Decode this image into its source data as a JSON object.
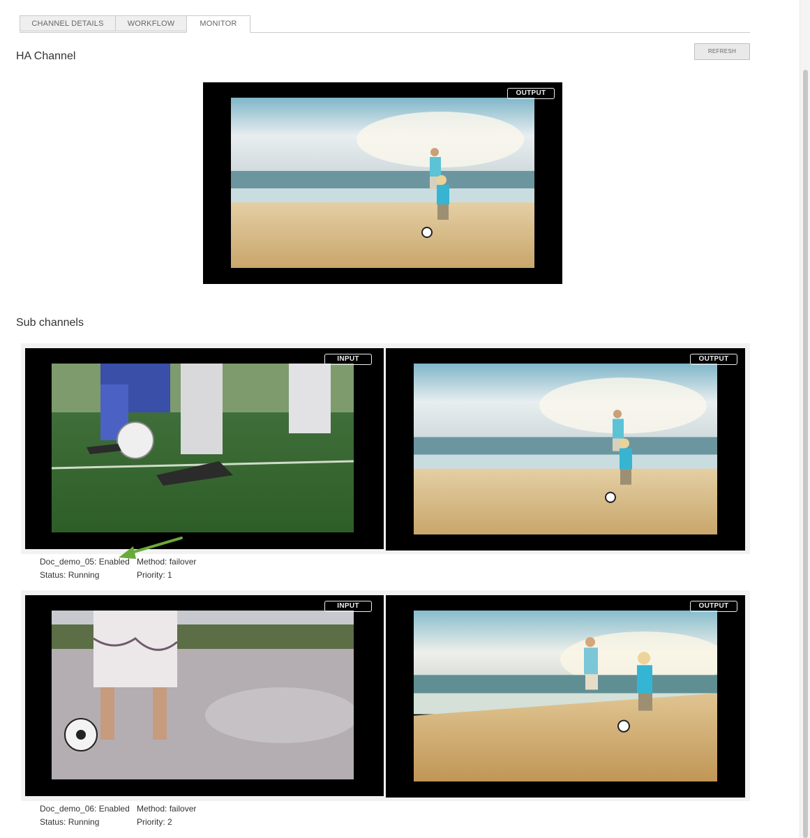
{
  "tabs": [
    {
      "label": "CHANNEL DETAILS"
    },
    {
      "label": "WORKFLOW"
    },
    {
      "label": "MONITOR",
      "active": true
    }
  ],
  "ha_channel": {
    "title": "HA Channel",
    "refresh_label": "REFRESH",
    "output_badge": "OUTPUT"
  },
  "sub_channels": {
    "title": "Sub channels",
    "items": [
      {
        "input_badge": "INPUT",
        "output_badge": "OUTPUT",
        "name_status": "Doc_demo_05: Enabled",
        "status": "Status: Running",
        "method": "Method: failover",
        "priority": "Priority: 1"
      },
      {
        "input_badge": "INPUT",
        "output_badge": "OUTPUT",
        "name_status": "Doc_demo_06: Enabled",
        "status": "Status: Running",
        "method": "Method: failover",
        "priority": "Priority: 2"
      }
    ]
  },
  "colors": {
    "annotation_arrow": "#6aaa3a",
    "player_bg": "#000000"
  }
}
